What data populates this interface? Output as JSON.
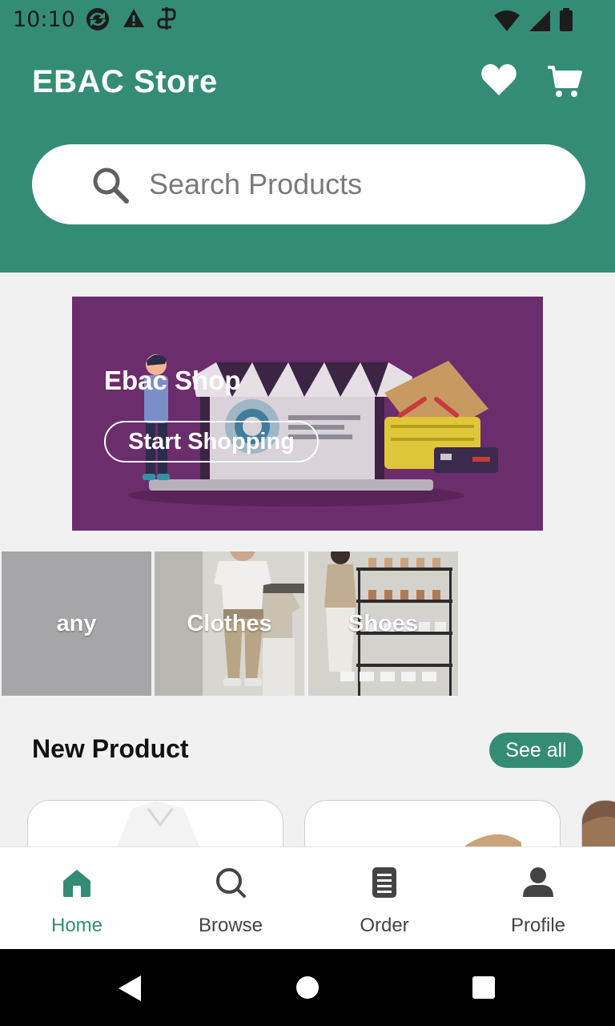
{
  "status_bar": {
    "time": "10:10",
    "left_icons": [
      "sync-icon",
      "warning-icon",
      "storage-icon"
    ],
    "right_icons": [
      "wifi-icon",
      "signal-icon",
      "battery-icon"
    ]
  },
  "header": {
    "title": "EBAC Store",
    "favorites_icon": "heart-icon",
    "cart_icon": "cart-icon"
  },
  "search": {
    "placeholder": "Search Products"
  },
  "banner": {
    "title": "Ebac Shop",
    "button_label": "Start Shopping",
    "background": "#6b2d6b"
  },
  "categories": [
    {
      "label": "any"
    },
    {
      "label": "Clothes"
    },
    {
      "label": "Shoes"
    }
  ],
  "new_product": {
    "title": "New Product",
    "see_all_label": "See all"
  },
  "bottom_nav": {
    "items": [
      {
        "label": "Home",
        "icon": "home-icon",
        "active": true
      },
      {
        "label": "Browse",
        "icon": "search-icon",
        "active": false
      },
      {
        "label": "Order",
        "icon": "order-icon",
        "active": false
      },
      {
        "label": "Profile",
        "icon": "person-icon",
        "active": false
      }
    ]
  },
  "system_nav": [
    "back-icon",
    "home-circle-icon",
    "recents-icon"
  ],
  "colors": {
    "primary": "#358c76",
    "background": "#f1f1f1",
    "banner": "#6b2d6b"
  }
}
